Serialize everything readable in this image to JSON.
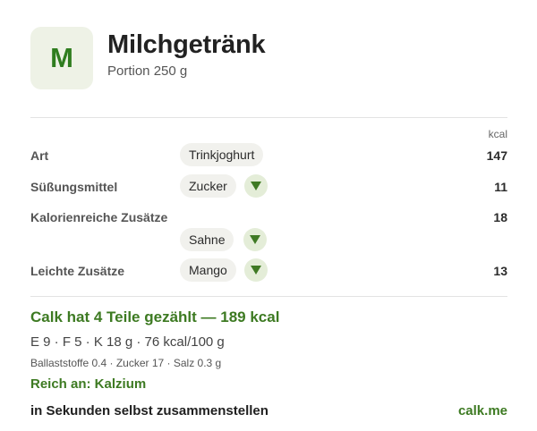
{
  "header": {
    "logo_letter": "M",
    "title": "Milchgetränk",
    "subtitle": "Portion 250 g"
  },
  "table": {
    "unit_header": "kcal",
    "rows": [
      {
        "label": "Art",
        "chip": "Trinkjoghurt",
        "kcal": "147"
      },
      {
        "label": "Süßungsmittel",
        "chip": "Zucker",
        "kcal": "11"
      },
      {
        "label": "Kalorienreiche Zusätze",
        "chip": "Sahne",
        "kcal": "18"
      },
      {
        "label": "Leichte Zusätze",
        "chip": "Mango",
        "kcal": "13"
      }
    ]
  },
  "summary": {
    "line": "Calk hat 4 Teile gezählt — 189 kcal",
    "macros": "E 9 · F 5 · K 18 g · 76 kcal/100 g",
    "micros": "Ballaststoffe 0.4 · Zucker 17 · Salz 0.3 g",
    "rich_in": "Reich an: Kalzium"
  },
  "footer": {
    "cta": "in Sekunden selbst zusammenstellen",
    "link": "calk.me"
  },
  "colors": {
    "accent": "#3d7a22",
    "logo_bg": "#eef2e6",
    "chip_bg": "#f1f1ed",
    "dropdown_bg": "#e4edd8",
    "dropdown_arrow": "#3f7a24"
  },
  "icons": {
    "dropdown": "triangle-down-icon"
  }
}
